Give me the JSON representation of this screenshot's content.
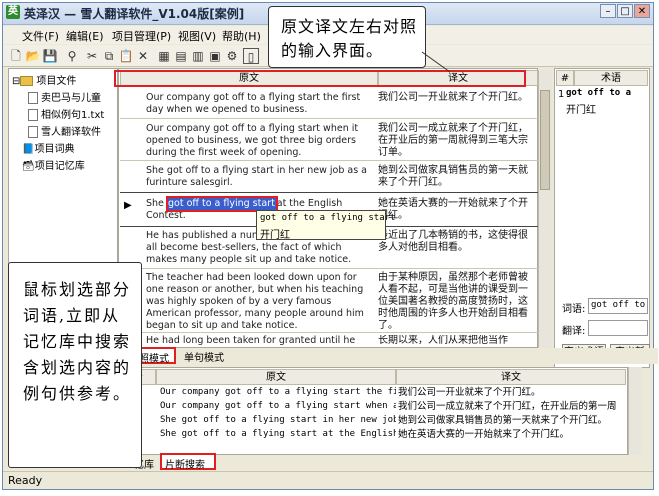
{
  "window": {
    "title": "英泽汉 — 雪人翻译软件_V1.04版[案例]"
  },
  "menu": [
    "文件(F)",
    "编辑(E)",
    "项目管理(P)",
    "视图(V)",
    "帮助(H)"
  ],
  "tree": {
    "root": "项目文件",
    "files": [
      "卖巴马与儿童",
      "相似例句1.txt",
      "雪人翻译软件"
    ],
    "dict": "项目词典",
    "memory": "项目记忆库"
  },
  "grid": {
    "header_source": "原文",
    "header_target": "译文",
    "rows": [
      {
        "src": "Our company got off to a flying start the first day when we opened to business.",
        "tgt": "我们公司一开业就来了个开门红。"
      },
      {
        "src": "Our company got off to a flying start when it opened to business, we got three big orders during the first week of opening.",
        "tgt": "我们公司一成立就来了个开门红，在开业后的第一周就得到三笔大宗订单。"
      },
      {
        "src": "She got off to a flying start in her new job as a furinture salesgirl.",
        "tgt": "她到公司做家具销售员的第一天就来了个开门红。"
      },
      {
        "src": "She got off to a flying start at the English Contest.",
        "tgt": "她在英语大赛的一开始就来了个开门红。"
      },
      {
        "src": "He has published a number of novels, and they all become best-sellers, the fact of which makes many people sit up and take notice.",
        "tgt": "最近出了几本畅销的书，这使得很多人对他刮目相看。"
      },
      {
        "src": "The teacher had been looked down upon for one reason or another, but when his teaching was highly spoken of by a very famous American professor, many people around him began to sit up and take notice.",
        "tgt": "由于某种原因，虽然那个老师曾被人看不起，可是当他讲的课受到一位美国著名教授的高度赞扬时，这时他周围的许多人也开始刮目相看了。"
      },
      {
        "src": "He had long been taken for granted until he",
        "tgt": "长期以来，人们从来把他当作"
      }
    ],
    "selected_phrase": "got off to a flying start"
  },
  "popup": {
    "source": "got off to a flying start",
    "target": "开门红"
  },
  "term_panel": {
    "col_num": "#",
    "col_term": "术语",
    "row_num": "1",
    "term_src": "got off to a",
    "term_tgt": "开门红",
    "word_label": "词语:",
    "word_value": "got off to",
    "trans_label": "翻译:",
    "btn_define": "定义术语",
    "btn_define_new": "定义新"
  },
  "mode_tabs": {
    "compare": "照模式",
    "single": "单句模式"
  },
  "lower": {
    "header_num": "号",
    "header_source": "原文",
    "header_target": "译文",
    "rows": [
      {
        "src": "Our company got off to a flying start the fi",
        "tgt": "我们公司一开业就来了个开门红。"
      },
      {
        "src": "Our company got off to a flying start when a",
        "tgt": "我们公司一成立就来了个开门红，在开业后的第一周"
      },
      {
        "src": "She got off to a flying start in her new job",
        "tgt": "她到公司做家具销售员的第一天就来了个开门红。"
      },
      {
        "src": "She got off to a flying start at the English",
        "tgt": "她在英语大赛的一开始就来了个开门红。"
      }
    ]
  },
  "bottom_tabs": {
    "memory": "忆库",
    "fragment": "片断搜索"
  },
  "status": "Ready",
  "callouts": {
    "top": "原文译文左右对照的输入界面。",
    "left": "鼠标划选部分词语,立即从记忆库中搜索含划选内容的例句供参考。"
  }
}
